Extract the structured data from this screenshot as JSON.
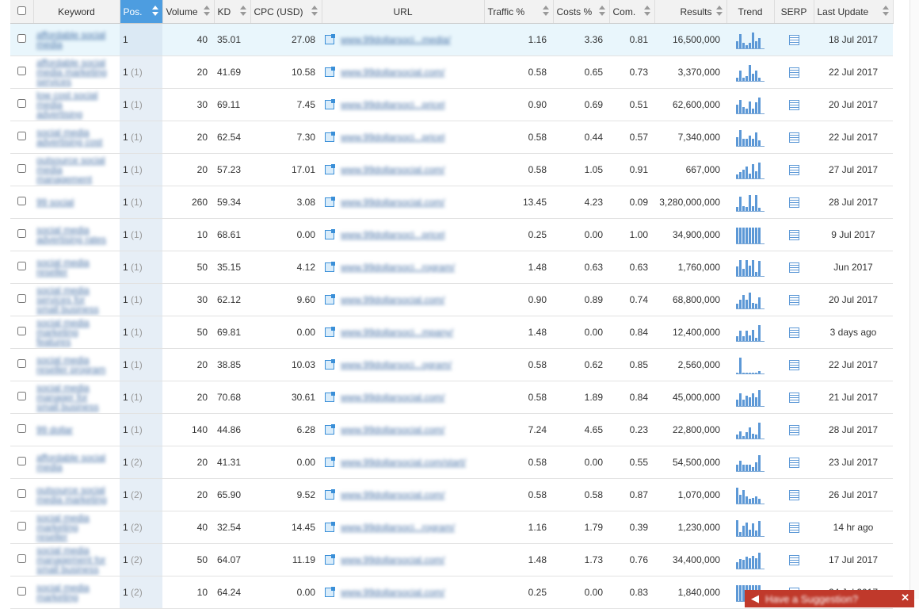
{
  "headers": {
    "keyword": "Keyword",
    "pos": "Pos.",
    "volume": "Volume",
    "kd": "KD",
    "cpc": "CPC (USD)",
    "url": "URL",
    "traffic": "Traffic %",
    "costs": "Costs %",
    "com": "Com.",
    "results": "Results",
    "trend": "Trend",
    "serp": "SERP",
    "last_update": "Last Update"
  },
  "rows": [
    {
      "keyword": "affordable social media",
      "pos": "1",
      "prev": "",
      "volume": "40",
      "kd": "35.01",
      "cpc": "27.08",
      "url": "www.99dollarsoci...media/",
      "traffic": "1.16",
      "costs": "3.36",
      "com": "0.81",
      "results": "16,500,000",
      "last_update": "18 Jul 2017",
      "trend": [
        4,
        8,
        3,
        2,
        3,
        9,
        4,
        6
      ]
    },
    {
      "keyword": "affordable social media marketing services",
      "pos": "1",
      "prev": "(1)",
      "volume": "20",
      "kd": "41.69",
      "cpc": "10.58",
      "url": "www.99dollarsocial.com/",
      "traffic": "0.58",
      "costs": "0.65",
      "com": "0.73",
      "results": "3,370,000",
      "last_update": "22 Jul 2017",
      "trend": [
        3,
        9,
        3,
        4,
        14,
        6,
        9,
        3
      ]
    },
    {
      "keyword": "low cost social media advertising",
      "pos": "1",
      "prev": "(1)",
      "volume": "30",
      "kd": "69.11",
      "cpc": "7.45",
      "url": "www.99dollarsoci...pricel",
      "traffic": "0.90",
      "costs": "0.69",
      "com": "0.51",
      "results": "62,600,000",
      "last_update": "20 Jul 2017",
      "trend": [
        7,
        11,
        5,
        4,
        10,
        4,
        9,
        13
      ]
    },
    {
      "keyword": "social media advertising cost",
      "pos": "1",
      "prev": "(1)",
      "volume": "20",
      "kd": "62.54",
      "cpc": "7.30",
      "url": "www.99dollarsoci...pricel",
      "traffic": "0.58",
      "costs": "0.44",
      "com": "0.57",
      "results": "7,340,000",
      "last_update": "22 Jul 2017",
      "trend": [
        8,
        14,
        6,
        6,
        9,
        6,
        12,
        5
      ]
    },
    {
      "keyword": "outsource social media management",
      "pos": "1",
      "prev": "(1)",
      "volume": "20",
      "kd": "57.23",
      "cpc": "17.01",
      "url": "www.99dollarsocial.com/",
      "traffic": "0.58",
      "costs": "1.05",
      "com": "0.91",
      "results": "667,000",
      "last_update": "27 Jul 2017",
      "trend": [
        3,
        5,
        7,
        10,
        4,
        12,
        6,
        13
      ]
    },
    {
      "keyword": "99 social",
      "pos": "1",
      "prev": "(1)",
      "volume": "260",
      "kd": "59.34",
      "cpc": "3.08",
      "url": "www.99dollarsocial.com/",
      "traffic": "13.45",
      "costs": "4.23",
      "com": "0.09",
      "results": "3,280,000,000",
      "last_update": "28 Jul 2017",
      "trend": [
        4,
        14,
        5,
        4,
        16,
        5,
        16,
        3
      ]
    },
    {
      "keyword": "social media advertising rates",
      "pos": "1",
      "prev": "(1)",
      "volume": "10",
      "kd": "68.61",
      "cpc": "0.00",
      "url": "www.99dollarsoci...pricel",
      "traffic": "0.25",
      "costs": "0.00",
      "com": "1.00",
      "results": "34,900,000",
      "last_update": "9 Jul 2017",
      "trend": [
        16,
        16,
        16,
        16,
        16,
        16,
        16,
        16
      ]
    },
    {
      "keyword": "social media reseller",
      "pos": "1",
      "prev": "(1)",
      "volume": "50",
      "kd": "35.15",
      "cpc": "4.12",
      "url": "www.99dollarsoci...rogram/",
      "traffic": "1.48",
      "costs": "0.63",
      "com": "0.63",
      "results": "1,760,000",
      "last_update": "Jun 2017",
      "trend": [
        9,
        15,
        7,
        15,
        10,
        15,
        4,
        14
      ]
    },
    {
      "keyword": "social media services for small business",
      "pos": "1",
      "prev": "(1)",
      "volume": "30",
      "kd": "62.12",
      "cpc": "9.60",
      "url": "www.99dollarsocial.com/",
      "traffic": "0.90",
      "costs": "0.89",
      "com": "0.74",
      "results": "68,800,000",
      "last_update": "20 Jul 2017",
      "trend": [
        4,
        8,
        12,
        8,
        14,
        5,
        4,
        10
      ]
    },
    {
      "keyword": "social media marketing features",
      "pos": "1",
      "prev": "(1)",
      "volume": "50",
      "kd": "69.81",
      "cpc": "0.00",
      "url": "www.99dollarsoci...mpany/",
      "traffic": "1.48",
      "costs": "0.00",
      "com": "0.84",
      "results": "12,400,000",
      "last_update": "3 days ago",
      "trend": [
        4,
        9,
        4,
        9,
        5,
        10,
        3,
        14
      ]
    },
    {
      "keyword": "social media reseller program",
      "pos": "1",
      "prev": "(1)",
      "volume": "20",
      "kd": "38.85",
      "cpc": "10.03",
      "url": "www.99dollarsoci...ogram/",
      "traffic": "0.58",
      "costs": "0.62",
      "com": "0.85",
      "results": "2,560,000",
      "last_update": "22 Jul 2017",
      "trend": [
        1,
        15,
        1,
        1,
        1,
        1,
        1,
        2
      ]
    },
    {
      "keyword": "social media manager for small business",
      "pos": "1",
      "prev": "(1)",
      "volume": "20",
      "kd": "70.68",
      "cpc": "30.61",
      "url": "www.99dollarsocial.com/",
      "traffic": "0.58",
      "costs": "1.89",
      "com": "0.84",
      "results": "45,000,000",
      "last_update": "21 Jul 2017",
      "trend": [
        6,
        12,
        6,
        10,
        8,
        12,
        8,
        15
      ]
    },
    {
      "keyword": "99 dollar",
      "pos": "1",
      "prev": "(1)",
      "volume": "140",
      "kd": "44.86",
      "cpc": "6.28",
      "url": "www.99dollarsocial.com/",
      "traffic": "7.24",
      "costs": "4.65",
      "com": "0.23",
      "results": "22,800,000",
      "last_update": "28 Jul 2017",
      "trend": [
        3,
        6,
        2,
        5,
        9,
        4,
        3,
        13
      ]
    },
    {
      "keyword": "affordable social media",
      "pos": "1",
      "prev": "(2)",
      "volume": "20",
      "kd": "41.31",
      "cpc": "0.00",
      "url": "www.99dollarsocial.com/start/",
      "traffic": "0.58",
      "costs": "0.00",
      "com": "0.55",
      "results": "54,500,000",
      "last_update": "23 Jul 2017",
      "trend": [
        6,
        10,
        6,
        6,
        6,
        4,
        8,
        15
      ]
    },
    {
      "keyword": "outsource social media marketing",
      "pos": "1",
      "prev": "(2)",
      "volume": "20",
      "kd": "65.90",
      "cpc": "9.52",
      "url": "www.99dollarsocial.com/",
      "traffic": "0.58",
      "costs": "0.58",
      "com": "0.87",
      "results": "1,070,000",
      "last_update": "26 Jul 2017",
      "trend": [
        14,
        8,
        12,
        6,
        4,
        5,
        6,
        4
      ]
    },
    {
      "keyword": "social media marketing reseller",
      "pos": "1",
      "prev": "(2)",
      "volume": "40",
      "kd": "32.54",
      "cpc": "14.45",
      "url": "www.99dollarsoci...rogram/",
      "traffic": "1.16",
      "costs": "1.79",
      "com": "0.39",
      "results": "1,230,000",
      "last_update": "14 hr ago",
      "trend": [
        15,
        4,
        10,
        13,
        6,
        12,
        5,
        14
      ]
    },
    {
      "keyword": "social media management for small business",
      "pos": "1",
      "prev": "(2)",
      "volume": "50",
      "kd": "64.07",
      "cpc": "11.19",
      "url": "www.99dollarsocial.com/",
      "traffic": "1.48",
      "costs": "1.73",
      "com": "0.76",
      "results": "34,400,000",
      "last_update": "17 Jul 2017",
      "trend": [
        6,
        9,
        8,
        11,
        10,
        12,
        10,
        15
      ]
    },
    {
      "keyword": "social media marketing",
      "pos": "1",
      "prev": "(2)",
      "volume": "10",
      "kd": "64.24",
      "cpc": "0.00",
      "url": "www.99dollarsocial.com/",
      "traffic": "0.25",
      "costs": "0.00",
      "com": "0.83",
      "results": "1,840,000",
      "last_update": "24 Jul 2017",
      "trend": [
        6,
        6,
        6,
        6,
        6,
        6,
        6,
        6
      ]
    }
  ],
  "toast": {
    "text": "Have a Suggestion?"
  },
  "colors": {
    "accent": "#4d9de0",
    "toast": "#c0392b"
  }
}
